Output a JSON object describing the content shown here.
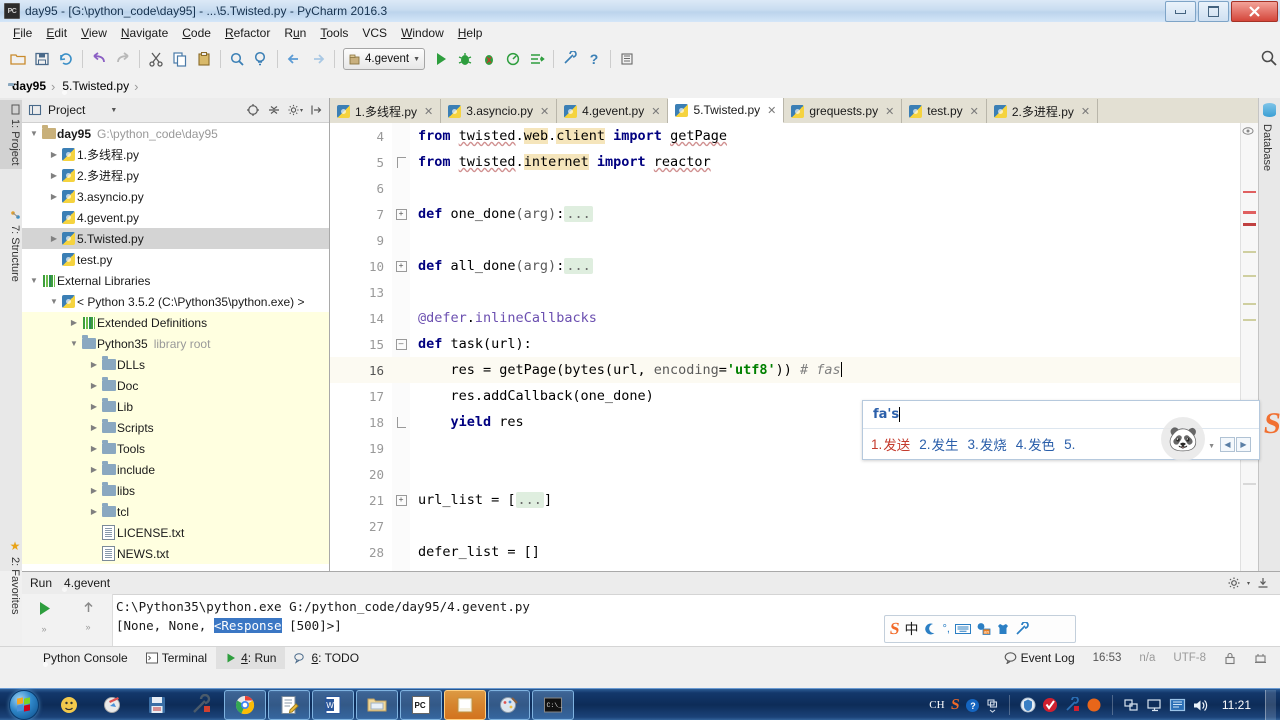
{
  "window": {
    "title": "day95 - [G:\\python_code\\day95] - ...\\5.Twisted.py - PyCharm 2016.3",
    "app_icon": "PC",
    "minimize": "—",
    "maximize": "□",
    "close": "✕"
  },
  "menu": {
    "items": [
      "File",
      "Edit",
      "View",
      "Navigate",
      "Code",
      "Refactor",
      "Run",
      "Tools",
      "VCS",
      "Window",
      "Help"
    ]
  },
  "toolbar": {
    "run_config": "4.gevent",
    "icons": [
      "open-folder-icon",
      "save-all-icon",
      "sync-icon",
      "undo-icon",
      "redo-icon",
      "cut-icon",
      "copy-icon",
      "paste-icon",
      "find-icon",
      "find-replace-icon",
      "back-icon",
      "forward-icon"
    ],
    "run_icon": "run-icon",
    "debug_icon": "debug-icon",
    "coverage_icon": "coverage-icon",
    "profile_icon": "profile-icon",
    "rerun_icon": "rerun-icon",
    "settings_icon": "settings-icon",
    "help_icon": "help-icon",
    "search_icon": "search-everywhere-icon"
  },
  "breadcrumb": {
    "project": "day95",
    "file": "5.Twisted.py",
    "separator": "›"
  },
  "left_tabs": [
    {
      "label": "1: Project",
      "mnemonic": "1",
      "active": true
    },
    {
      "label": "7: Structure",
      "mnemonic": "7",
      "active": false
    },
    {
      "label": "2: Favorites",
      "mnemonic": "2",
      "active": false
    }
  ],
  "right_tabs": [
    {
      "label": "Database"
    }
  ],
  "project_panel": {
    "title": "Project",
    "header_icons": [
      "target-icon",
      "collapse-icon",
      "gear-icon",
      "hide-icon"
    ],
    "tree": [
      {
        "indent": 0,
        "arrow": "down",
        "icon": "folder-tan",
        "label": "day95",
        "bold": true,
        "sub": "G:\\python_code\\day95",
        "style": "normal"
      },
      {
        "indent": 1,
        "arrow": "right",
        "icon": "python",
        "label": "1.多线程.py",
        "bold": false,
        "sub": "",
        "style": "normal"
      },
      {
        "indent": 1,
        "arrow": "right",
        "icon": "python",
        "label": "2.多进程.py",
        "bold": false,
        "sub": "",
        "style": "normal"
      },
      {
        "indent": 1,
        "arrow": "right",
        "icon": "python",
        "label": "3.asyncio.py",
        "bold": false,
        "sub": "",
        "style": "normal"
      },
      {
        "indent": 1,
        "arrow": "none",
        "icon": "python",
        "label": "4.gevent.py",
        "bold": false,
        "sub": "",
        "style": "normal"
      },
      {
        "indent": 1,
        "arrow": "right",
        "icon": "python",
        "label": "5.Twisted.py",
        "bold": false,
        "sub": "",
        "style": "selected"
      },
      {
        "indent": 1,
        "arrow": "none",
        "icon": "python",
        "label": "test.py",
        "bold": false,
        "sub": "",
        "style": "normal"
      },
      {
        "indent": 0,
        "arrow": "down",
        "icon": "libs",
        "label": "External Libraries",
        "bold": false,
        "sub": "",
        "style": "normal"
      },
      {
        "indent": 1,
        "arrow": "down",
        "icon": "python",
        "label": "< Python 3.5.2 (C:\\Python35\\python.exe) >",
        "bold": false,
        "sub": "",
        "style": "normal"
      },
      {
        "indent": 2,
        "arrow": "right",
        "icon": "libs",
        "label": "Extended Definitions",
        "bold": false,
        "sub": "",
        "style": "lib"
      },
      {
        "indent": 2,
        "arrow": "down",
        "icon": "folder",
        "label": "Python35",
        "bold": false,
        "sub": "library root",
        "style": "lib"
      },
      {
        "indent": 3,
        "arrow": "right",
        "icon": "folder",
        "label": "DLLs",
        "bold": false,
        "sub": "",
        "style": "lib"
      },
      {
        "indent": 3,
        "arrow": "right",
        "icon": "folder",
        "label": "Doc",
        "bold": false,
        "sub": "",
        "style": "lib"
      },
      {
        "indent": 3,
        "arrow": "right",
        "icon": "folder",
        "label": "Lib",
        "bold": false,
        "sub": "",
        "style": "lib"
      },
      {
        "indent": 3,
        "arrow": "right",
        "icon": "folder",
        "label": "Scripts",
        "bold": false,
        "sub": "",
        "style": "lib"
      },
      {
        "indent": 3,
        "arrow": "right",
        "icon": "folder",
        "label": "Tools",
        "bold": false,
        "sub": "",
        "style": "lib"
      },
      {
        "indent": 3,
        "arrow": "right",
        "icon": "folder",
        "label": "include",
        "bold": false,
        "sub": "",
        "style": "lib"
      },
      {
        "indent": 3,
        "arrow": "right",
        "icon": "folder",
        "label": "libs",
        "bold": false,
        "sub": "",
        "style": "lib"
      },
      {
        "indent": 3,
        "arrow": "right",
        "icon": "folder",
        "label": "tcl",
        "bold": false,
        "sub": "",
        "style": "lib"
      },
      {
        "indent": 3,
        "arrow": "none",
        "icon": "text",
        "label": "LICENSE.txt",
        "bold": false,
        "sub": "",
        "style": "lib"
      },
      {
        "indent": 3,
        "arrow": "none",
        "icon": "text",
        "label": "NEWS.txt",
        "bold": false,
        "sub": "",
        "style": "lib"
      }
    ]
  },
  "editor_tabs": [
    {
      "label": "1.多线程.py",
      "active": false,
      "close": "✕"
    },
    {
      "label": "3.asyncio.py",
      "active": false,
      "close": "✕"
    },
    {
      "label": "4.gevent.py",
      "active": false,
      "close": "✕"
    },
    {
      "label": "5.Twisted.py",
      "active": true,
      "close": "✕"
    },
    {
      "label": "grequests.py",
      "active": false,
      "close": "✕"
    },
    {
      "label": "test.py",
      "active": false,
      "close": "✕"
    },
    {
      "label": "2.多进程.py",
      "active": false,
      "close": "✕"
    }
  ],
  "code": {
    "lines": [
      {
        "num": "4",
        "fold": "",
        "highlight": false
      },
      {
        "num": "5",
        "fold": "bracket-top",
        "highlight": false
      },
      {
        "num": "6",
        "fold": "",
        "highlight": false
      },
      {
        "num": "7",
        "fold": "plus",
        "highlight": false
      },
      {
        "num": "9",
        "fold": "",
        "highlight": false
      },
      {
        "num": "10",
        "fold": "plus",
        "highlight": false
      },
      {
        "num": "13",
        "fold": "",
        "highlight": false
      },
      {
        "num": "14",
        "fold": "",
        "highlight": false
      },
      {
        "num": "15",
        "fold": "minus",
        "highlight": false
      },
      {
        "num": "16",
        "fold": "",
        "highlight": true
      },
      {
        "num": "17",
        "fold": "",
        "highlight": false
      },
      {
        "num": "18",
        "fold": "bracket-bot",
        "highlight": false
      },
      {
        "num": "19",
        "fold": "",
        "highlight": false
      },
      {
        "num": "20",
        "fold": "",
        "highlight": false
      },
      {
        "num": "21",
        "fold": "plus",
        "highlight": false
      },
      {
        "num": "27",
        "fold": "",
        "highlight": false
      },
      {
        "num": "28",
        "fold": "",
        "highlight": false
      }
    ],
    "text": [
      "from twisted.web.client import getPage",
      "from twisted.internet import reactor",
      "",
      "def one_done(arg):...",
      "",
      "def all_done(arg):...",
      "",
      "@defer.inlineCallbacks",
      "def task(url):",
      "    res = getPage(bytes(url, encoding='utf8')) # fas",
      "    res.addCallback(one_done)",
      "    yield res",
      "",
      "",
      "url_list = [...]",
      "",
      "defer_list = []"
    ]
  },
  "ime": {
    "input": "fa's",
    "candidates": [
      {
        "num": "1.",
        "word": "发送"
      },
      {
        "num": "2.",
        "word": "发生"
      },
      {
        "num": "3.",
        "word": "发烧"
      },
      {
        "num": "4.",
        "word": "发色"
      },
      {
        "num": "5.",
        "word": ""
      }
    ],
    "emoji": "🐼",
    "prev_arrow": "◀",
    "next_arrow": "▶",
    "brand": "S"
  },
  "run_panel": {
    "title": "Run",
    "config_name": "4.gevent",
    "command": "C:\\Python35\\python.exe G:/python_code/day95/4.gevent.py",
    "output_pre": "[None, None, ",
    "output_sel": "<Response",
    "output_post": " [500]>]",
    "gear_icon": "gear-icon",
    "hide_icon": "hide-icon",
    "rerun_icon": "rerun-icon",
    "up_icon": "up-icon"
  },
  "statusbar": {
    "tabs": [
      {
        "label": "Python Console",
        "icon": "python-icon",
        "active": false
      },
      {
        "label": "Terminal",
        "icon": "terminal-icon",
        "active": false
      },
      {
        "label": "4: Run",
        "mnemonic": "4",
        "icon": "run-icon",
        "active": true
      },
      {
        "label": "6: TODO",
        "mnemonic": "6",
        "icon": "todo-icon",
        "active": false
      }
    ],
    "event_log": "Event Log",
    "event_log_icon": "balloon-icon",
    "position": "16:53",
    "line_sep": "n/a",
    "encoding": "UTF-8",
    "lock_icon": "lock-icon",
    "hector_icon": "hector-icon"
  },
  "sogou_toolbar": {
    "logo": "S",
    "mode": "中",
    "moon_icon": "moon-icon",
    "punctuation_icon": "punctuation-icon",
    "keyboard_icon": "keyboard-icon",
    "expression_icon": "expression-icon",
    "skin_icon": "skin-icon",
    "toolbox_icon": "toolbox-icon"
  },
  "taskbar": {
    "start_label": "Start",
    "apps": [
      {
        "name": "explorer-icon",
        "state": "pinned"
      },
      {
        "name": "media-player-icon",
        "state": "pinned"
      },
      {
        "name": "save-app-icon",
        "state": "pinned"
      },
      {
        "name": "tool-app-icon",
        "state": "pinned"
      },
      {
        "name": "chrome-icon",
        "state": "running"
      },
      {
        "name": "notepad-icon",
        "state": "running"
      },
      {
        "name": "word-icon",
        "state": "running"
      },
      {
        "name": "folder-icon",
        "state": "running"
      },
      {
        "name": "pycharm-icon",
        "state": "running"
      },
      {
        "name": "active-app-icon",
        "state": "active"
      },
      {
        "name": "paint-icon",
        "state": "running"
      },
      {
        "name": "cmd-icon",
        "state": "running"
      }
    ],
    "tray": {
      "lang": "CH",
      "sogou_icon": "sogou-icon",
      "help_icon": "help-icon",
      "overflow_icon": "overflow-icon",
      "shield_icon": "shield-icon",
      "antivirus_icon": "antivirus-icon",
      "tool_icon": "tool-icon",
      "orange_icon": "orange-dot-icon",
      "network_icon": "network-icon",
      "monitor_icon": "monitor-icon",
      "display_icon": "display-icon",
      "volume_icon": "volume-icon",
      "clock": "11:21"
    }
  },
  "colors": {
    "accent": "#3b77c4",
    "keyword": "#000080",
    "string": "#008000",
    "comment": "#808080",
    "decorator": "#6b4fb0",
    "highlight_word": "#f5e5bb",
    "selection": "#3b77c4",
    "lib_bg": "#ffffe0",
    "sogou_orange": "#f26a28"
  }
}
